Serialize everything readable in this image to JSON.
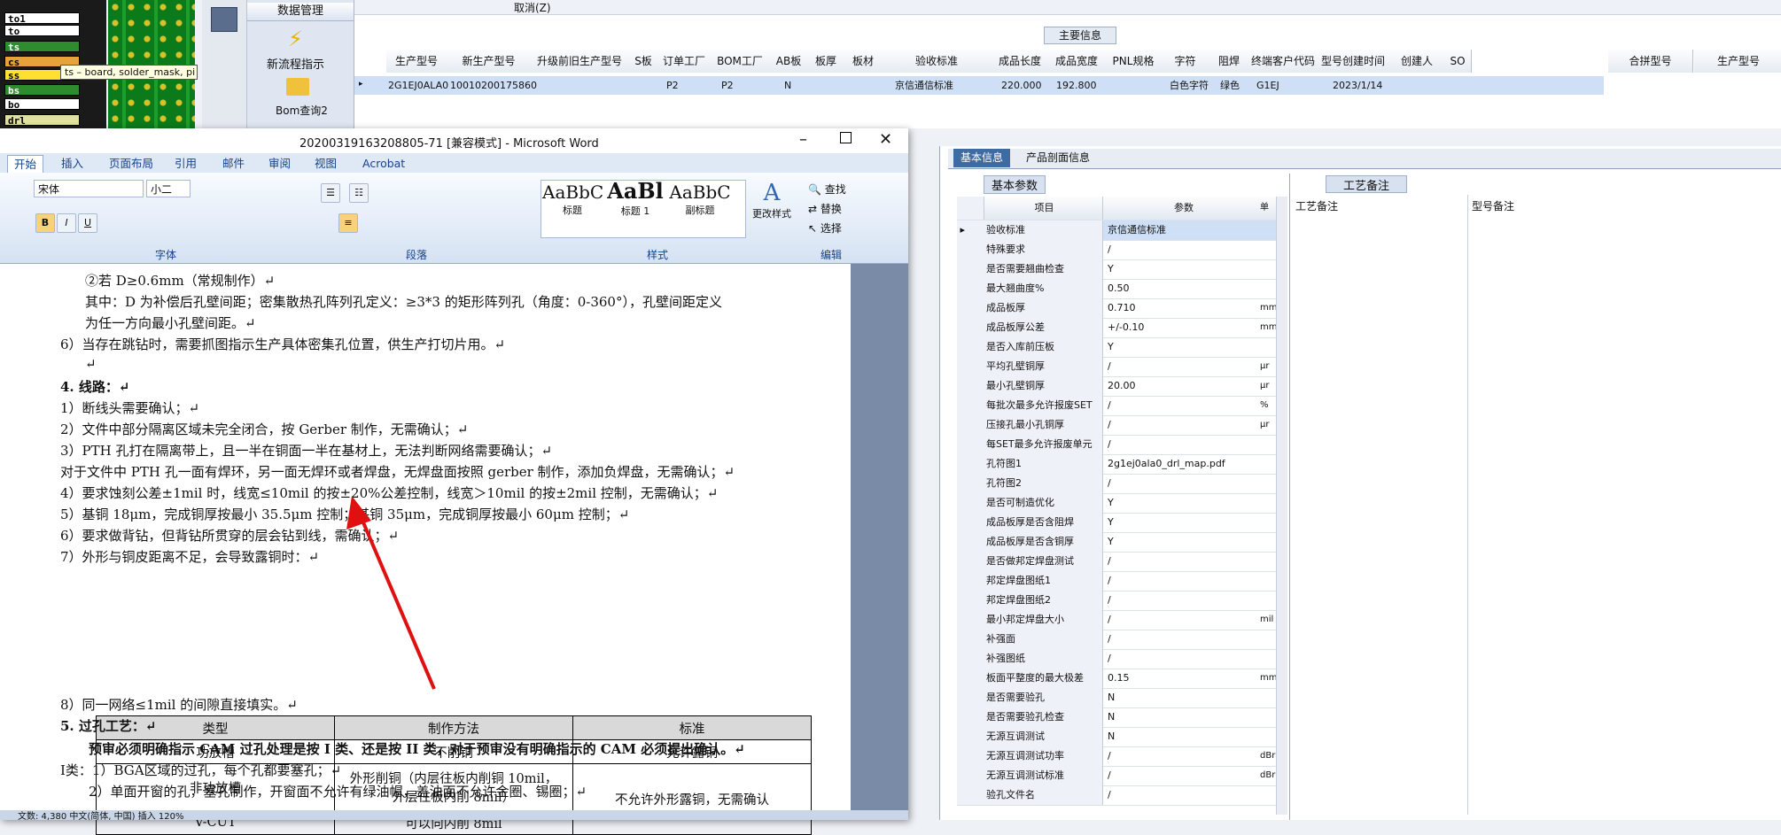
{
  "layers": [
    {
      "name": "to1",
      "bg": "#ffffff",
      "color": "#000000"
    },
    {
      "name": "to",
      "bg": "#ffffff",
      "color": "#000000"
    },
    {
      "name": "ts",
      "bg": "#2e8b2e",
      "color": "#ffffff"
    },
    {
      "name": "cs",
      "bg": "#e8a23a",
      "color": "#000000"
    },
    {
      "name": "ss",
      "bg": "#ffe030",
      "color": "#000000"
    },
    {
      "name": "bs",
      "bg": "#2e8b2e",
      "color": "#ffffff"
    },
    {
      "name": "bo",
      "bg": "#ffffff",
      "color": "#000000"
    },
    {
      "name": "drl",
      "bg": "#e0e0a0",
      "color": "#000000"
    }
  ],
  "tooltip": "ts – board, solder_mask, pi",
  "toolpanel": {
    "data_mgmt": "数据管理",
    "new_flow": "新流程指示",
    "bom_query": "Bom查询2"
  },
  "toprow": {
    "cancel": "取消(Z)"
  },
  "main_info": "主要信息",
  "columns": [
    "生产型号",
    "新生产型号",
    "升级前旧生产型号",
    "S板",
    "订单工厂",
    "BOM工厂",
    "AB板",
    "板厚",
    "板材",
    "验收标准",
    "成品长度",
    "成品宽度",
    "PNL规格",
    "字符",
    "阻焊",
    "终端客户代码",
    "型号创建时间",
    "创建人",
    "SO"
  ],
  "right_cols": [
    "合拼型号",
    "生产型号"
  ],
  "row": {
    "prod": "2G1EJ0ALA0",
    "newprod": "10010200175860",
    "factory": "P2",
    "bom": "P2",
    "ab": "N",
    "std": "京信通信标准",
    "len": "220.000",
    "wid": "192.800",
    "char": "白色字符",
    "mask": "绿色",
    "cust": "G1EJ",
    "time": "2023/1/14"
  },
  "rtabs": [
    "基本信息",
    "产品剖面信息"
  ],
  "basic_params": "基本参数",
  "craft_note": "工艺备注",
  "param_hdr": {
    "k": "项目",
    "v": "参数",
    "u": "单"
  },
  "craft_cols": [
    "工艺备注",
    "型号备注"
  ],
  "params": [
    {
      "k": "验收标准",
      "v": "京信通信标准",
      "u": ""
    },
    {
      "k": "特殊要求",
      "v": "/",
      "u": ""
    },
    {
      "k": "是否需要翘曲检查",
      "v": "Y",
      "u": ""
    },
    {
      "k": "最大翘曲度%",
      "v": "0.50",
      "u": ""
    },
    {
      "k": "成品板厚",
      "v": "0.710",
      "u": "mm"
    },
    {
      "k": "成品板厚公差",
      "v": "+/-0.10",
      "u": "mm"
    },
    {
      "k": "是否入库前压板",
      "v": "Y",
      "u": ""
    },
    {
      "k": "平均孔壁铜厚",
      "v": "/",
      "u": "μr"
    },
    {
      "k": "最小孔壁铜厚",
      "v": "20.00",
      "u": "μr"
    },
    {
      "k": "每批次最多允许报废SET",
      "v": "/",
      "u": "%"
    },
    {
      "k": "压接孔最小孔铜厚",
      "v": "/",
      "u": "μr"
    },
    {
      "k": "每SET最多允许报废单元",
      "v": "/",
      "u": ""
    },
    {
      "k": "孔符图1",
      "v": "2g1ej0ala0_drl_map.pdf",
      "u": ""
    },
    {
      "k": "孔符图2",
      "v": "/",
      "u": ""
    },
    {
      "k": "是否可制造优化",
      "v": "Y",
      "u": ""
    },
    {
      "k": "成品板厚是否含阻焊",
      "v": "Y",
      "u": ""
    },
    {
      "k": "成品板厚是否含铜厚",
      "v": "Y",
      "u": ""
    },
    {
      "k": "是否做邦定焊盘测试",
      "v": "/",
      "u": ""
    },
    {
      "k": "邦定焊盘图纸1",
      "v": "/",
      "u": ""
    },
    {
      "k": "邦定焊盘图纸2",
      "v": "/",
      "u": ""
    },
    {
      "k": "最小邦定焊盘大小",
      "v": "/",
      "u": "mil"
    },
    {
      "k": "补强面",
      "v": "/",
      "u": ""
    },
    {
      "k": "补强图纸",
      "v": "/",
      "u": ""
    },
    {
      "k": "板面平整度的最大极差",
      "v": "0.15",
      "u": "mm"
    },
    {
      "k": "是否需要验孔",
      "v": "N",
      "u": ""
    },
    {
      "k": "是否需要验孔检查",
      "v": "N",
      "u": ""
    },
    {
      "k": "无源互调测试",
      "v": "N",
      "u": ""
    },
    {
      "k": "无源互调测试功率",
      "v": "/",
      "u": "dBr"
    },
    {
      "k": "无源互调测试标准",
      "v": "/",
      "u": "dBr"
    },
    {
      "k": "验孔文件名",
      "v": "/",
      "u": ""
    }
  ],
  "word": {
    "title": "20200319163208805-71 [兼容模式] - Microsoft Word",
    "tabs": [
      "开始",
      "插入",
      "页面布局",
      "引用",
      "邮件",
      "审阅",
      "视图",
      "Acrobat"
    ],
    "font": "宋体",
    "size": "小二",
    "groups": [
      "字体",
      "段落",
      "样式",
      "编辑"
    ],
    "styles": [
      {
        "sample": "AaBbC",
        "name": "标题"
      },
      {
        "sample": "AaBl",
        "name": "标题 1"
      },
      {
        "sample": "AaBbC",
        "name": "副标题"
      }
    ],
    "change_style": "更改样式",
    "edit": [
      "查找",
      "替换",
      "选择"
    ],
    "lines": [
      "②若 D≥0.6mm（常规制作）↵",
      "其中：D 为补偿后孔壁间距；密集散热孔阵列孔定义：≥3*3 的矩形阵列孔（角度：0-360°），孔壁间距定义",
      "为任一方向最小孔壁间距。↵",
      "6）当存在跳钻时，需要抓图指示生产具体密集孔位置，供生产打切片用。↵",
      "↵",
      "4.   线路：↵",
      "1）断线头需要确认；↵",
      "2）文件中部分隔离区域未完全闭合，按 Gerber 制作，无需确认；↵",
      "3）PTH 孔打在隔离带上，且一半在铜面一半在基材上，无法判断网络需要确认；↵",
      "对于文件中 PTH 孔一面有焊环，另一面无焊环或者焊盘，无焊盘面按照 gerber 制作，添加负焊盘，无需确认；↵",
      "4）要求蚀刻公差±1mil 时，线宽≤10mil 的按±20%公差控制，线宽＞10mil 的按±2mil 控制，无需确认；↵",
      "5）基铜 18μm，完成铜厚按最小 35.5μm 控制；基铜 35μm，完成铜厚按最小 60μm 控制；↵",
      "6）要求做背钻，但背钻所贯穿的层会钻到线，需确认；↵",
      "7）外形与铜皮距离不足，会导致露铜时：↵"
    ],
    "table": {
      "head": [
        "类型",
        "制作方法",
        "标准"
      ],
      "r1": [
        "功放槽",
        "不削铜",
        "允许露铜"
      ],
      "r2a": "非功放槽",
      "r2b1": "外形削铜（内层往板内削铜 10mil，",
      "r2b2": "外层往板内削 8mil）",
      "r23c": "不允许外形露铜，无需确认",
      "r3": [
        "V-CUT",
        "可以向内削 8mil"
      ]
    },
    "after": [
      "8）同一网络≤1mil 的间隙直接填实。↵",
      "5.   过孔工艺：↵",
      "预审必须明确指示 CAM 过孔处理是按 I 类、还是按 II 类，对于预审没有明确指示的 CAM 必须提出确认。↵",
      "I类：1）BGA区域的过孔，每个孔都要塞孔；↵",
      "2）单面开窗的孔，塞孔制作，开窗面不允许有绿油帽，盖油面不允许金圈、锡圈；↵"
    ],
    "status": "文数: 4,380    中文(简体, 中国)    插入    120%"
  }
}
